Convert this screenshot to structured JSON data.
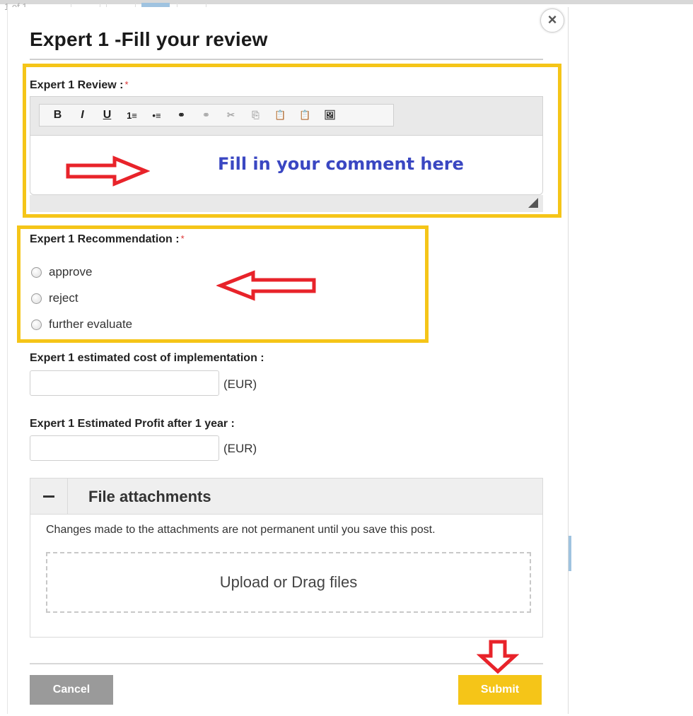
{
  "page_background": {
    "pager_text": "1 of 1"
  },
  "dialog": {
    "title": "Expert 1 -Fill your review",
    "close_symbol": "×"
  },
  "review": {
    "label": "Expert 1 Review :",
    "required_mark": "*",
    "toolbar": [
      {
        "icon": "bold-icon",
        "glyph": "B",
        "enabled": true
      },
      {
        "icon": "italic-icon",
        "glyph": "I",
        "enabled": true
      },
      {
        "icon": "underline-icon",
        "glyph": "U",
        "enabled": true
      },
      {
        "icon": "numbered-list-icon",
        "glyph": "1≡",
        "enabled": true
      },
      {
        "icon": "bullet-list-icon",
        "glyph": "•≡",
        "enabled": true
      },
      {
        "icon": "link-icon",
        "glyph": "⚭",
        "enabled": true
      },
      {
        "icon": "unlink-icon",
        "glyph": "⚭",
        "enabled": false
      },
      {
        "icon": "cut-icon",
        "glyph": "✂",
        "enabled": false
      },
      {
        "icon": "copy-icon",
        "glyph": "⎘",
        "enabled": false
      },
      {
        "icon": "paste-icon",
        "glyph": "📋",
        "enabled": true
      },
      {
        "icon": "paste-word-icon",
        "glyph": "📋",
        "enabled": true
      },
      {
        "icon": "image-icon",
        "glyph": "🖼",
        "enabled": true
      }
    ],
    "annotation_text": "Fill in your comment here"
  },
  "recommendation": {
    "label": "Expert 1 Recommendation :",
    "required_mark": "*",
    "options": [
      "approve",
      "reject",
      "further evaluate"
    ],
    "selected": null
  },
  "cost": {
    "label": "Expert 1 estimated cost of implementation :",
    "value": "",
    "unit": "(EUR)"
  },
  "profit": {
    "label": "Expert 1 Estimated Profit after 1 year :",
    "value": "",
    "unit": "(EUR)"
  },
  "attachments": {
    "toggle_symbol": "−",
    "title": "File attachments",
    "note": "Changes made to the attachments are not permanent until you save this post.",
    "dropzone_text": "Upload or Drag files"
  },
  "buttons": {
    "cancel": "Cancel",
    "submit": "Submit"
  },
  "colors": {
    "highlight": "#f5c518",
    "annotation_arrow": "#e8232a",
    "annotation_text": "#3a47c2",
    "submit_bg": "#f5c518",
    "cancel_bg": "#9a9a9a"
  }
}
